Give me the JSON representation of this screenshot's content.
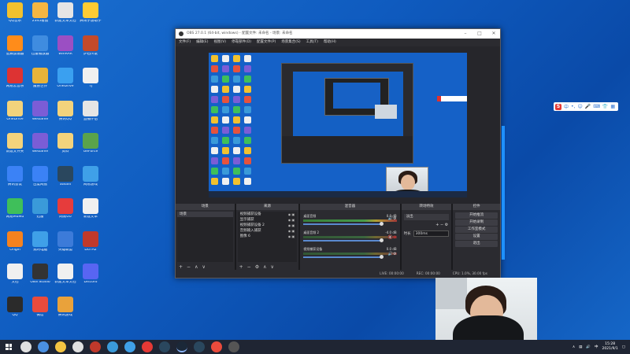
{
  "desktop": {
    "icons": [
      {
        "label": "QQ音乐",
        "color": "#f2c12e"
      },
      {
        "label": "2345看图",
        "color": "#f5b642"
      },
      {
        "label": "新建文本文档",
        "color": "#e5e5e5"
      },
      {
        "label": "腾讯手游助手",
        "color": "#ffcc33"
      },
      {
        "label": "星辰加速器",
        "color": "#ff8c1a"
      },
      {
        "label": "迅雷播放器",
        "color": "#3f8ce0"
      },
      {
        "label": "WinRAR",
        "color": "#9b4fc3"
      },
      {
        "label": "炉石传说",
        "color": "#c44a2a"
      },
      {
        "label": "网易云音乐",
        "color": "#d33"
      },
      {
        "label": "魔兽世界",
        "color": "#e8b339"
      },
      {
        "label": "OneDrive",
        "color": "#3aa0f0"
      },
      {
        "label": "TJ",
        "color": "#f0f0f0"
      },
      {
        "label": "OneDrive",
        "color": "#f3d37c"
      },
      {
        "label": "WeGame",
        "color": "#7b5dd6"
      },
      {
        "label": "腾讯QQ",
        "color": "#f3d37c"
      },
      {
        "label": "直播伴侣",
        "color": "#e5e5e5"
      },
      {
        "label": "新建文件夹",
        "color": "#f3d37c"
      },
      {
        "label": "WeGame",
        "color": "#7b5dd6"
      },
      {
        "label": "资料",
        "color": "#f3d37c"
      },
      {
        "label": "GeForce",
        "color": "#5aa34b"
      },
      {
        "label": "腾讯会议",
        "color": "#3b82f6"
      },
      {
        "label": "百度网盘",
        "color": "#3b82f6"
      },
      {
        "label": "Steam",
        "color": "#2a475e"
      },
      {
        "label": "网易游戏",
        "color": "#3fa0e8"
      },
      {
        "label": "网易MuMu",
        "color": "#3fbf5a"
      },
      {
        "label": "迅雷",
        "color": "#3a9ad9"
      },
      {
        "label": "网易UU",
        "color": "#e63c3c"
      },
      {
        "label": "新建文本",
        "color": "#f0f0f0"
      },
      {
        "label": "Origin",
        "color": "#f5821f"
      },
      {
        "label": "我的电脑",
        "color": "#3fa0e8"
      },
      {
        "label": "英雄联盟",
        "color": "#3c7bd9"
      },
      {
        "label": "DOTA2",
        "color": "#c0392b"
      },
      {
        "label": "文档",
        "color": "#f0f0f0"
      },
      {
        "label": "OBS Studio",
        "color": "#333"
      },
      {
        "label": "新建文本文档",
        "color": "#f0f0f0"
      },
      {
        "label": "Discord",
        "color": "#5865f2"
      },
      {
        "label": "QQ",
        "color": "#2b2b2b"
      },
      {
        "label": "微信",
        "color": "#e94b3c"
      },
      {
        "label": "腾讯游戏",
        "color": "#e9a23b"
      }
    ]
  },
  "obs": {
    "title": "OBS 27.0.1 (64-bit, windows) - 配置文件: 未命名 - 场景: 未命名",
    "menu": [
      "文件(F)",
      "编辑(E)",
      "视图(V)",
      "停靠部件(D)",
      "配置文件(P)",
      "场景集合(S)",
      "工具(T)",
      "帮助(H)"
    ],
    "docks": {
      "scenes": {
        "title": "场景",
        "items": [
          "场景"
        ]
      },
      "sources": {
        "title": "来源",
        "items": [
          "视频捕获设备",
          "显示捕获",
          "视频捕获设备 2",
          "音频输入捕获",
          "图像 6"
        ]
      },
      "mixer": {
        "title": "混音器",
        "channels": [
          {
            "name": "桌面音频",
            "db": "0.0 dB"
          },
          {
            "name": "桌面音频 2",
            "db": "-4.0 dB"
          },
          {
            "name": "视频捕获设备",
            "db": "0.0 dB"
          }
        ]
      },
      "transitions": {
        "title": "转场特效",
        "selected": "淡出",
        "duration_label": "时长",
        "duration": "300ms"
      },
      "controls": {
        "title": "控件",
        "buttons": [
          "开始推流",
          "开始录制",
          "工作室模式",
          "设置",
          "退出"
        ]
      }
    },
    "status": {
      "live": "LIVE: 00:00:00",
      "rec": "REC: 00:00:00",
      "cpu": "CPU: 1.0%, 30.00 fps"
    }
  },
  "ime": {
    "label": "中"
  },
  "taskbar": {
    "time": "15:28",
    "date": "2021/9/1"
  }
}
